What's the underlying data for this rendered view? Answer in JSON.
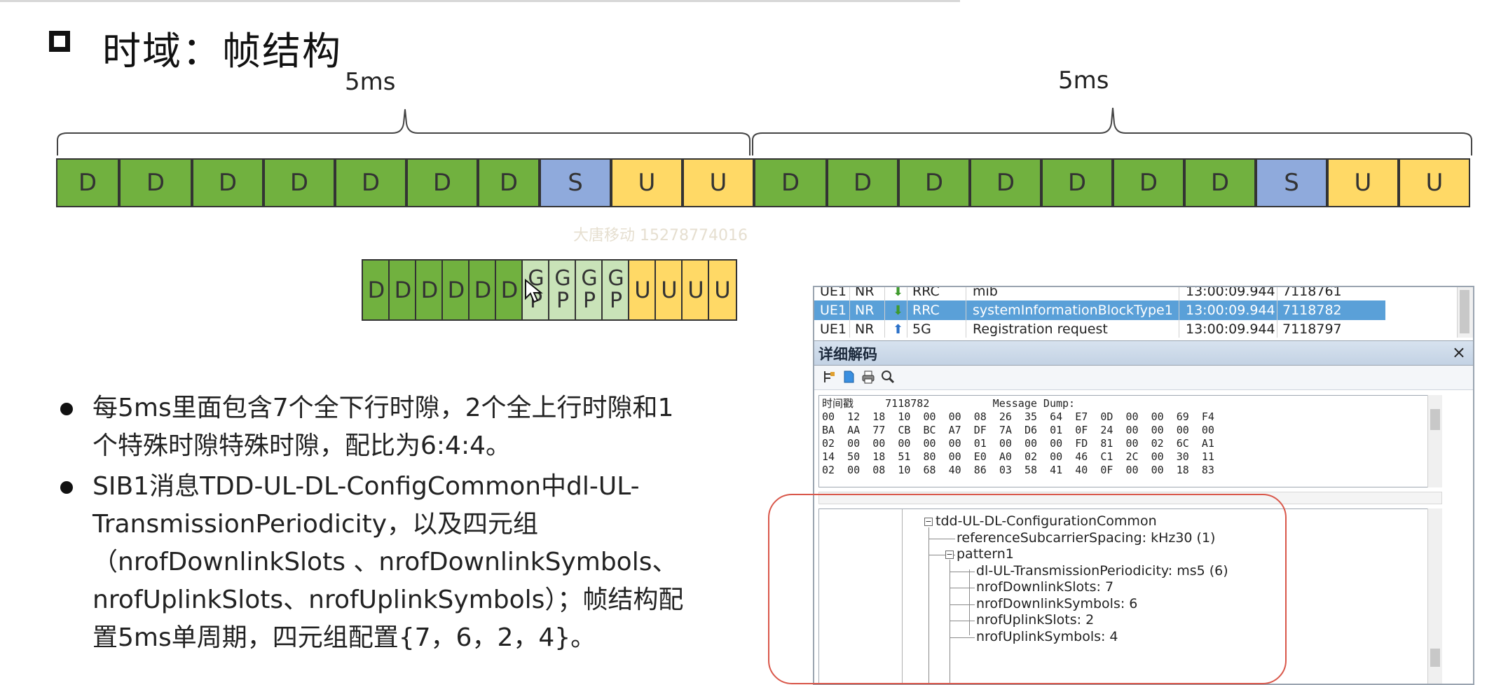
{
  "slide": {
    "title": "时域：帧结构",
    "period_labels": [
      "5ms",
      "5ms"
    ],
    "watermark": "大唐移动 15278774016"
  },
  "frame": {
    "slots": [
      "D",
      "D",
      "D",
      "D",
      "D",
      "D",
      "D",
      "S",
      "U",
      "U",
      "D",
      "D",
      "D",
      "D",
      "D",
      "D",
      "D",
      "S",
      "U",
      "U"
    ]
  },
  "special_slot": {
    "symbols": [
      "D",
      "D",
      "D",
      "D",
      "D",
      "D",
      "GP",
      "GP",
      "GP",
      "GP",
      "U",
      "U",
      "U",
      "U"
    ]
  },
  "bullets": [
    "每5ms里面包含7个全下行时隙，2个全上行时隙和1个特殊时隙特殊时隙，配比为6:4:4。",
    "SIB1消息TDD-UL-DL-ConfigCommon中dl-UL-TransmissionPeriodicity，以及四元组（nrofDownlinkSlots 、nrofDownlinkSymbols、nrofUplinkSlots、nrofUplinkSymbols）；帧结构配置5ms单周期，四元组配置{7，6，2，4}。"
  ],
  "app": {
    "messages": [
      {
        "ue": "UE1",
        "rat": "NR",
        "dir": "down",
        "layer": "RRC",
        "name": "mib",
        "time": "13:00:09.944",
        "id": "7118761",
        "selected": false
      },
      {
        "ue": "UE1",
        "rat": "NR",
        "dir": "down",
        "layer": "RRC",
        "name": "systemInformationBlockType1",
        "time": "13:00:09.944",
        "id": "7118782",
        "selected": true
      },
      {
        "ue": "UE1",
        "rat": "NR",
        "dir": "up",
        "layer": "5G",
        "name": "Registration request",
        "time": "13:00:09.944",
        "id": "7118797",
        "selected": false
      }
    ],
    "panel_title": "详细解码",
    "close_symbol": "×",
    "hex_dump": "时间戳     7118782          Message Dump:\n00  12  18  10  00  00  08  26  35  64  E7  0D  00  00  69  F4\nBA  AA  77  CB  BC  A7  DF  7A  D6  01  0F  24  00  00  00  00\n02  00  00  00  00  00  01  00  00  00  FD  81  00  02  6C  A1\n14  50  18  51  80  00  E0  A0  02  00  46  C1  2C  00  30  11\n02  00  08  10  68  40  86  03  58  41  40  0F  00  00  18  83",
    "tree": [
      {
        "label": "tdd-UL-DL-ConfigurationCommon",
        "level": 0,
        "expander": "minus"
      },
      {
        "label": "referenceSubcarrierSpacing: kHz30 (1)",
        "level": 1,
        "expander": ""
      },
      {
        "label": "pattern1",
        "level": 1,
        "expander": "minus"
      },
      {
        "label": "dl-UL-TransmissionPeriodicity: ms5 (6)",
        "level": 2,
        "expander": ""
      },
      {
        "label": "nrofDownlinkSlots: 7",
        "level": 2,
        "expander": ""
      },
      {
        "label": "nrofDownlinkSymbols: 6",
        "level": 2,
        "expander": ""
      },
      {
        "label": "nrofUplinkSlots: 2",
        "level": 2,
        "expander": ""
      },
      {
        "label": "nrofUplinkSymbols: 4",
        "level": 2,
        "expander": ""
      }
    ]
  },
  "colors": {
    "downlink": "#71b13f",
    "special": "#8faadc",
    "uplink": "#ffd966",
    "guard": "#c3dfb1",
    "selection": "#5aa0d8",
    "highlight_ring": "#d9574a"
  }
}
